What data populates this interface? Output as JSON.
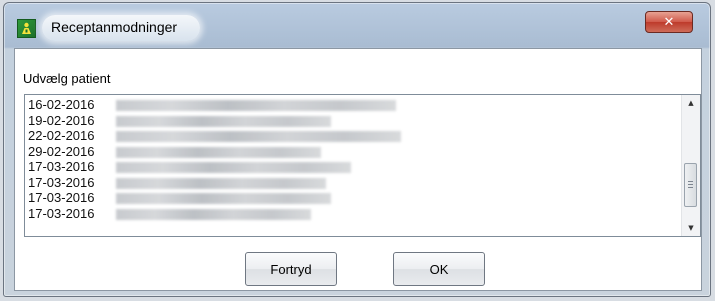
{
  "window": {
    "title": "Receptanmodninger",
    "close_symbol": "✕"
  },
  "section": {
    "label": "Udvælg patient"
  },
  "patient_list": {
    "rows": [
      {
        "date": "16-02-2016",
        "name_redacted": true
      },
      {
        "date": "19-02-2016",
        "name_redacted": true
      },
      {
        "date": "22-02-2016",
        "name_redacted": true
      },
      {
        "date": "29-02-2016",
        "name_redacted": true
      },
      {
        "date": "17-03-2016",
        "name_redacted": true
      },
      {
        "date": "17-03-2016",
        "name_redacted": true
      },
      {
        "date": "17-03-2016",
        "name_redacted": true
      },
      {
        "date": "17-03-2016",
        "name_redacted": true
      }
    ]
  },
  "buttons": {
    "cancel_label": "Fortryd",
    "ok_label": "OK"
  },
  "icons": {
    "app": "app-logo-icon",
    "close": "close-icon",
    "scroll_up": "scroll-up-arrow-icon",
    "scroll_down": "scroll-down-arrow-icon"
  },
  "colors": {
    "close_button": "#c9473a",
    "app_icon": "#2f9b3c"
  }
}
